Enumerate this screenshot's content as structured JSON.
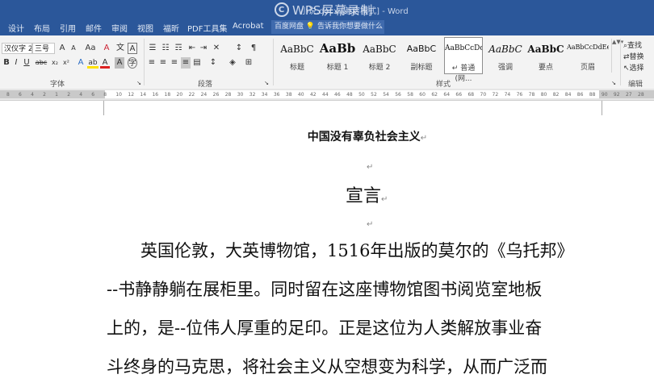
{
  "title_bar": {
    "doc_name": "小说.docx [兼容模式] - Word"
  },
  "watermark": {
    "logo_letter": "C",
    "text": "WPS屏幕录制"
  },
  "tabs": [
    "设计",
    "布局",
    "引用",
    "邮件",
    "审阅",
    "视图",
    "福昕",
    "PDF工具集",
    "Acrobat",
    "百度网盘"
  ],
  "search": {
    "placeholder": "告诉我你想要做什么"
  },
  "ribbon": {
    "font_name": "汉仪字 2",
    "font_size": "三号",
    "group_font": "字体",
    "group_paragraph": "段落",
    "group_styles": "样式",
    "group_editing": "编辑",
    "font_buttons": {
      "grow": "A",
      "shrink": "A",
      "change_case": "Aa",
      "clear_format": "A",
      "phonetic": "文",
      "border": "A",
      "bold": "B",
      "italic": "I",
      "underline": "U",
      "strike": "abc",
      "subscript": "x₂",
      "superscript": "x²",
      "text_effect": "A",
      "highlight": "ab",
      "font_color": "A",
      "shading": "A",
      "enclose": "字"
    },
    "paragraph_buttons": {
      "bullets": "☰",
      "numbering": "☷",
      "multilevel": "☶",
      "decrease_indent": "⇤",
      "increase_indent": "⇥",
      "chinese_layout": "✕",
      "sort": "↕",
      "show_marks": "¶",
      "align_left": "≡",
      "center": "≡",
      "align_right": "≡",
      "justify": "≡",
      "distribute": "▤",
      "line_spacing": "↕",
      "shading": "◈",
      "borders": "⊞"
    },
    "styles": [
      {
        "sample": "AaBbC",
        "name": "标题"
      },
      {
        "sample": "AaBb",
        "name": "标题 1"
      },
      {
        "sample": "AaBbC",
        "name": "标题 2"
      },
      {
        "sample": "AaBbC",
        "name": "副标题"
      },
      {
        "sample": "AaBbCcDc",
        "name": "↵ 普通(网..."
      },
      {
        "sample": "AaBbC",
        "name": "强调"
      },
      {
        "sample": "AaBbC",
        "name": "要点"
      },
      {
        "sample": "AaBbCcDdEe",
        "name": "页眉"
      }
    ],
    "gallery_arrows": "▲▼▾",
    "editing": {
      "find": "查找",
      "replace": "替换",
      "select": "选择"
    }
  },
  "ruler": {
    "ticks": [
      "8",
      "6",
      "4",
      "2",
      "1",
      "2",
      "4",
      "6",
      "8",
      "10",
      "12",
      "14",
      "16",
      "18",
      "20",
      "22",
      "24",
      "26",
      "28",
      "30",
      "32",
      "34",
      "36",
      "38",
      "40",
      "42",
      "44",
      "46",
      "48",
      "50",
      "52",
      "54",
      "56",
      "58",
      "60",
      "62",
      "64",
      "66",
      "68",
      "70",
      "72",
      "74",
      "76",
      "78",
      "80",
      "82",
      "84",
      "86",
      "88",
      "90",
      "92",
      "27",
      "28"
    ]
  },
  "document": {
    "title": "中国没有辜负社会主义",
    "heading": "宣言",
    "paragraph_mark": "↵",
    "lines": [
      "　　英国伦敦，大英博物馆，1516年出版的莫尔的《乌托邦》",
      "--书静静躺在展柜里。同时留在这座博物馆图书阅览室地板",
      "上的，是--位伟人厚重的足印。正是这位为人类解放事业奋",
      "斗终身的马克思，将社会主义从空想变为科学，从而广泛而"
    ]
  }
}
